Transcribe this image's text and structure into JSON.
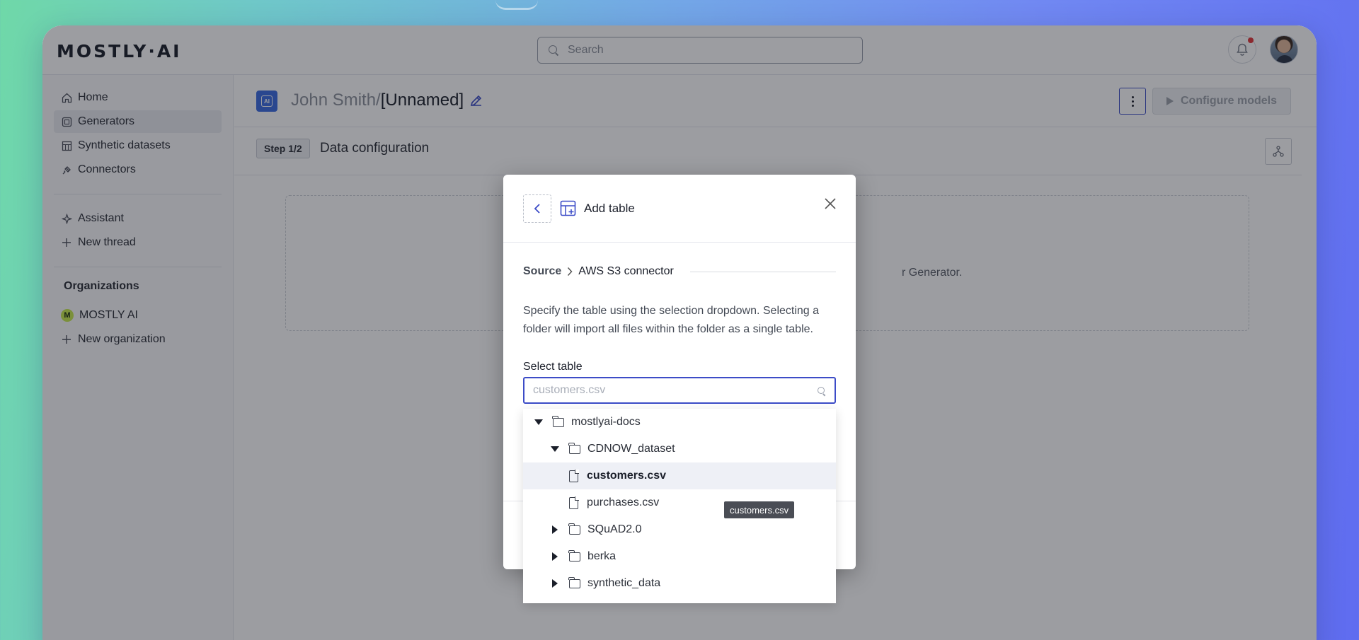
{
  "app": {
    "logo": "MOSTLY·AI",
    "search_placeholder": "Search"
  },
  "sidebar": {
    "nav": [
      {
        "label": "Home",
        "icon": "home-icon"
      },
      {
        "label": "Generators",
        "icon": "generator-icon",
        "active": true
      },
      {
        "label": "Synthetic datasets",
        "icon": "table-icon"
      },
      {
        "label": "Connectors",
        "icon": "plug-icon"
      }
    ],
    "assistant": [
      {
        "label": "Assistant",
        "icon": "sparkle-icon"
      },
      {
        "label": "New thread",
        "icon": "plus-icon"
      }
    ],
    "organizations_heading": "Organizations",
    "orgs": [
      {
        "label": "MOSTLY AI",
        "badge": "M"
      },
      {
        "label": "New organization",
        "icon": "plus-icon"
      }
    ]
  },
  "generator": {
    "owner": "John Smith/",
    "name": "[Unnamed]",
    "configure_button": "Configure models",
    "step_badge": "Step 1/2",
    "step_title": "Data configuration",
    "dropzone_text": "r Generator."
  },
  "modal": {
    "title": "Add table",
    "breadcrumb_source": "Source",
    "breadcrumb_connector": "AWS S3 connector",
    "description": "Specify the table using the selection dropdown. Selecting a folder will import all files within the folder as a single table.",
    "select_label": "Select table",
    "select_placeholder": "customers.csv"
  },
  "tree": {
    "root": "mostlyai-docs",
    "folder_open": "CDNOW_dataset",
    "file_selected": "customers.csv",
    "file_other": "purchases.csv",
    "folder_squad": "SQuAD2.0",
    "folder_berka": "berka",
    "folder_synthetic": "synthetic_data"
  },
  "tooltip": "customers.csv",
  "colors": {
    "accent": "#3c4cc7",
    "brand_blue": "#3c6ce0",
    "notification": "#e2363a"
  }
}
